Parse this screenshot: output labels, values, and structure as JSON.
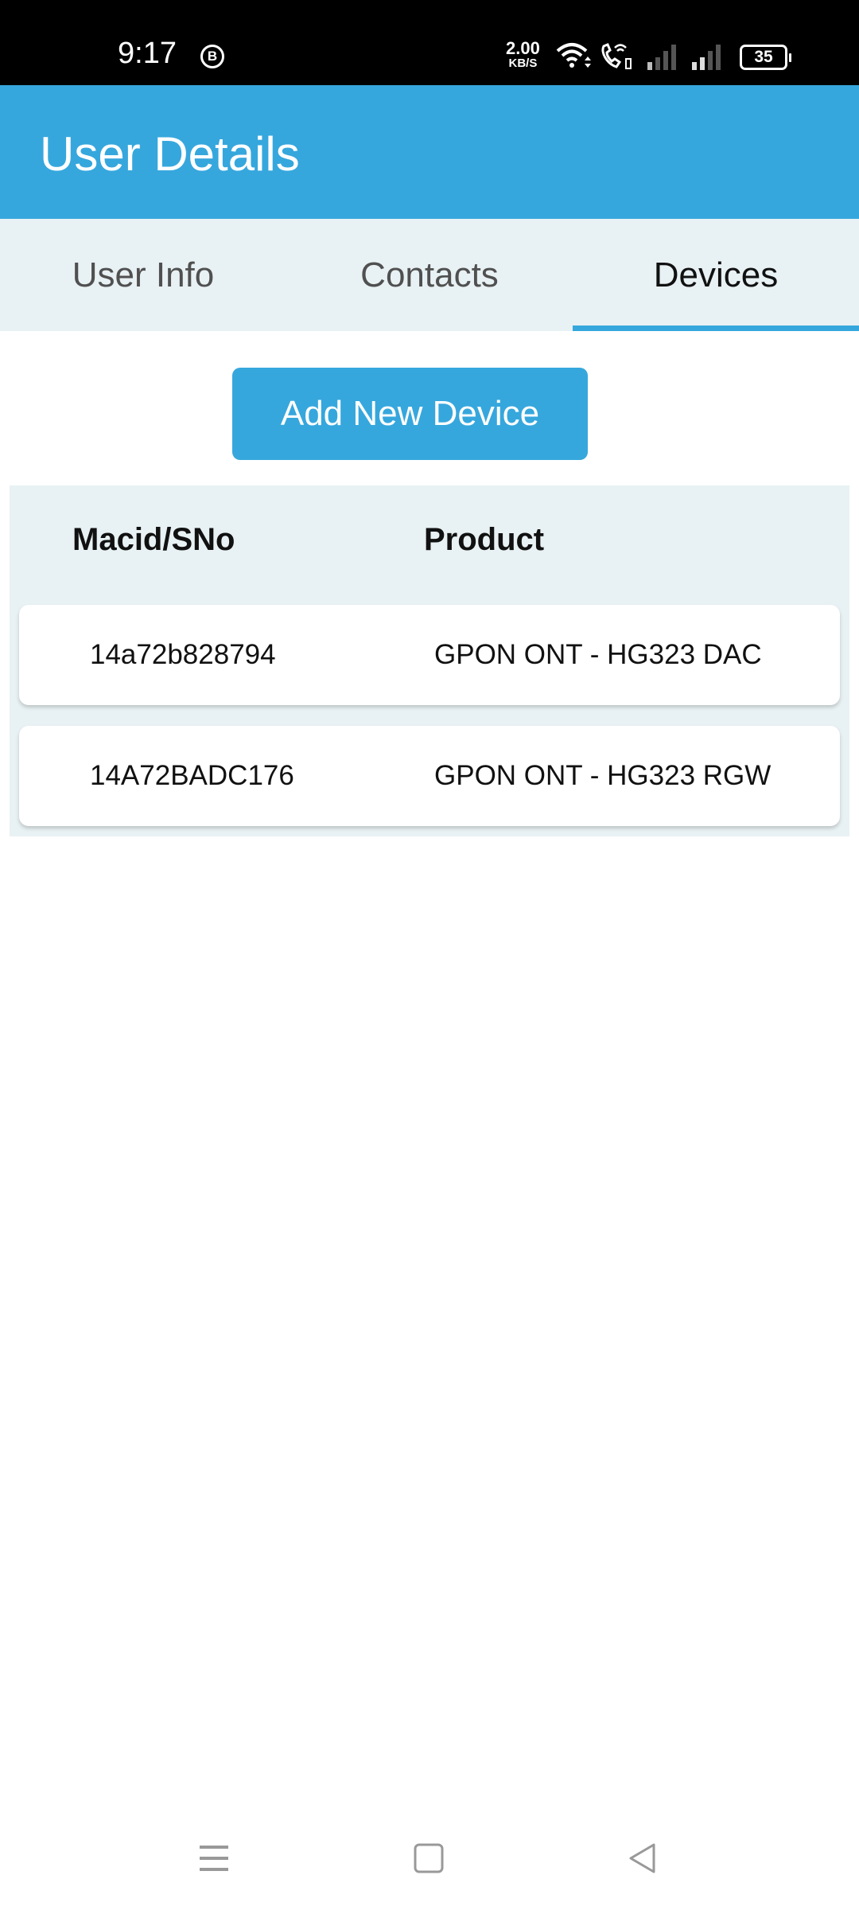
{
  "status_bar": {
    "time": "9:17",
    "notification_icon": "b-chat-icon",
    "net_speed_value": "2.00",
    "net_speed_unit": "KB/S",
    "icons": [
      "wifi-icon",
      "wifi-call-icon",
      "signal-icon",
      "signal-icon"
    ],
    "battery_level": "35"
  },
  "header": {
    "title": "User Details"
  },
  "tabs": [
    {
      "label": "User Info",
      "active": false
    },
    {
      "label": "Contacts",
      "active": false
    },
    {
      "label": "Devices",
      "active": true
    }
  ],
  "devices": {
    "add_button_label": "Add New Device",
    "columns": [
      "Macid/SNo",
      "Product"
    ],
    "rows": [
      {
        "macid": "14a72b828794",
        "product": "GPON ONT - HG323 DAC"
      },
      {
        "macid": "14A72BADC176",
        "product": "GPON ONT - HG323 RGW"
      }
    ]
  },
  "nav_bar": {
    "buttons": [
      "menu-icon",
      "home-icon",
      "back-icon"
    ]
  },
  "colors": {
    "accent": "#36a7dd",
    "tab_bg": "#e8f1f3",
    "text": "#111111"
  }
}
